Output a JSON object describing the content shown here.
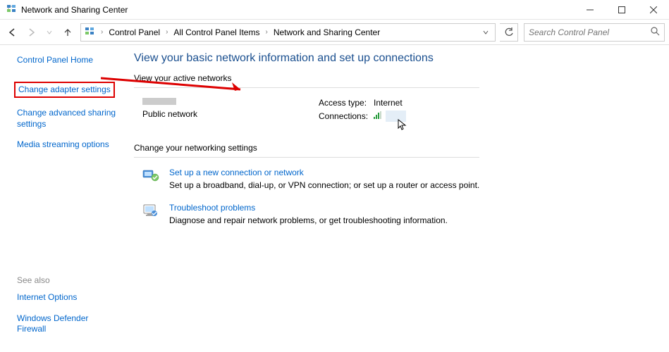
{
  "window": {
    "title": "Network and Sharing Center"
  },
  "breadcrumb": {
    "parts": [
      "Control Panel",
      "All Control Panel Items",
      "Network and Sharing Center"
    ]
  },
  "search": {
    "placeholder": "Search Control Panel"
  },
  "sidebar": {
    "home": "Control Panel Home",
    "links": [
      "Change adapter settings",
      "Change advanced sharing settings",
      "Media streaming options"
    ],
    "see_also_label": "See also",
    "see_also": [
      "Internet Options",
      "Windows Defender Firewall"
    ]
  },
  "main": {
    "heading": "View your basic network information and set up connections",
    "active_label": "View your active networks",
    "network": {
      "type": "Public network",
      "access_label": "Access type:",
      "access_value": "Internet",
      "conn_label": "Connections:"
    },
    "settings_label": "Change your networking settings",
    "options": [
      {
        "title": "Set up a new connection or network",
        "desc": "Set up a broadband, dial-up, or VPN connection; or set up a router or access point."
      },
      {
        "title": "Troubleshoot problems",
        "desc": "Diagnose and repair network problems, or get troubleshooting information."
      }
    ]
  }
}
